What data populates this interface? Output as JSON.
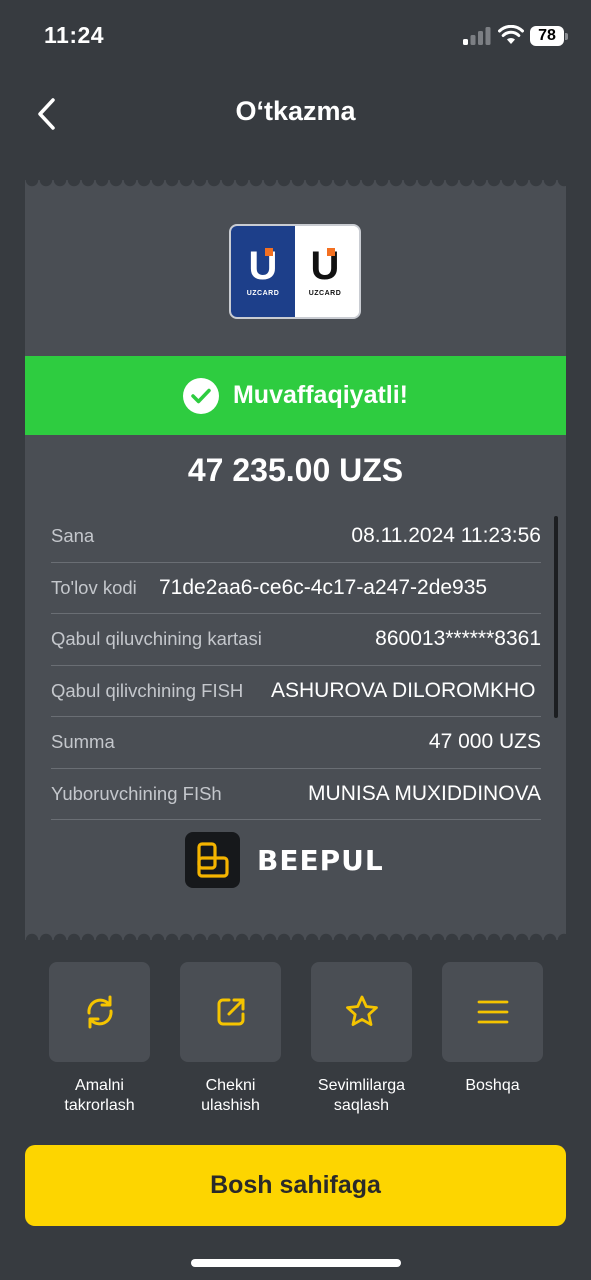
{
  "status_bar": {
    "time": "11:24",
    "battery": "78"
  },
  "header": {
    "title": "O‘tkazma"
  },
  "card_logo": {
    "left_brand": "UZCARD",
    "right_brand": "UZCARD"
  },
  "receipt": {
    "status": "Muvaffaqiyatli!",
    "amount": "47 235.00 UZS",
    "rows": [
      {
        "label": "Sana",
        "value": "08.11.2024 11:23:56"
      },
      {
        "label": "To'lov kodi",
        "value": "71de2aa6-ce6c-4c17-a247-2de935"
      },
      {
        "label": "Qabul qiluvchining kartasi",
        "value": "860013******8361"
      },
      {
        "label": "Qabul qilivchining FISH",
        "value": "ASHUROVA DILOROMKHO"
      },
      {
        "label": "Summa",
        "value": "47 000 UZS"
      },
      {
        "label": "Yuboruvchining  FISh",
        "value": "MUNISA MUXIDDINOVA"
      }
    ],
    "provider": "BEEPUL"
  },
  "actions": [
    {
      "label_line1": "Amalni",
      "label_line2": "takrorlash",
      "icon": "repeat-icon"
    },
    {
      "label_line1": "Chekni",
      "label_line2": "ulashish",
      "icon": "share-icon"
    },
    {
      "label_line1": "Sevimlilarga",
      "label_line2": "saqlash",
      "icon": "star-icon"
    },
    {
      "label_line1": "Boshqa",
      "label_line2": "",
      "icon": "menu-icon"
    }
  ],
  "home_button": {
    "label": "Bosh sahifaga"
  },
  "colors": {
    "background": "#373b40",
    "card": "#4a4e54",
    "success": "#2ecc40",
    "accent": "#fdd500",
    "icon_yellow": "#f5c400"
  }
}
